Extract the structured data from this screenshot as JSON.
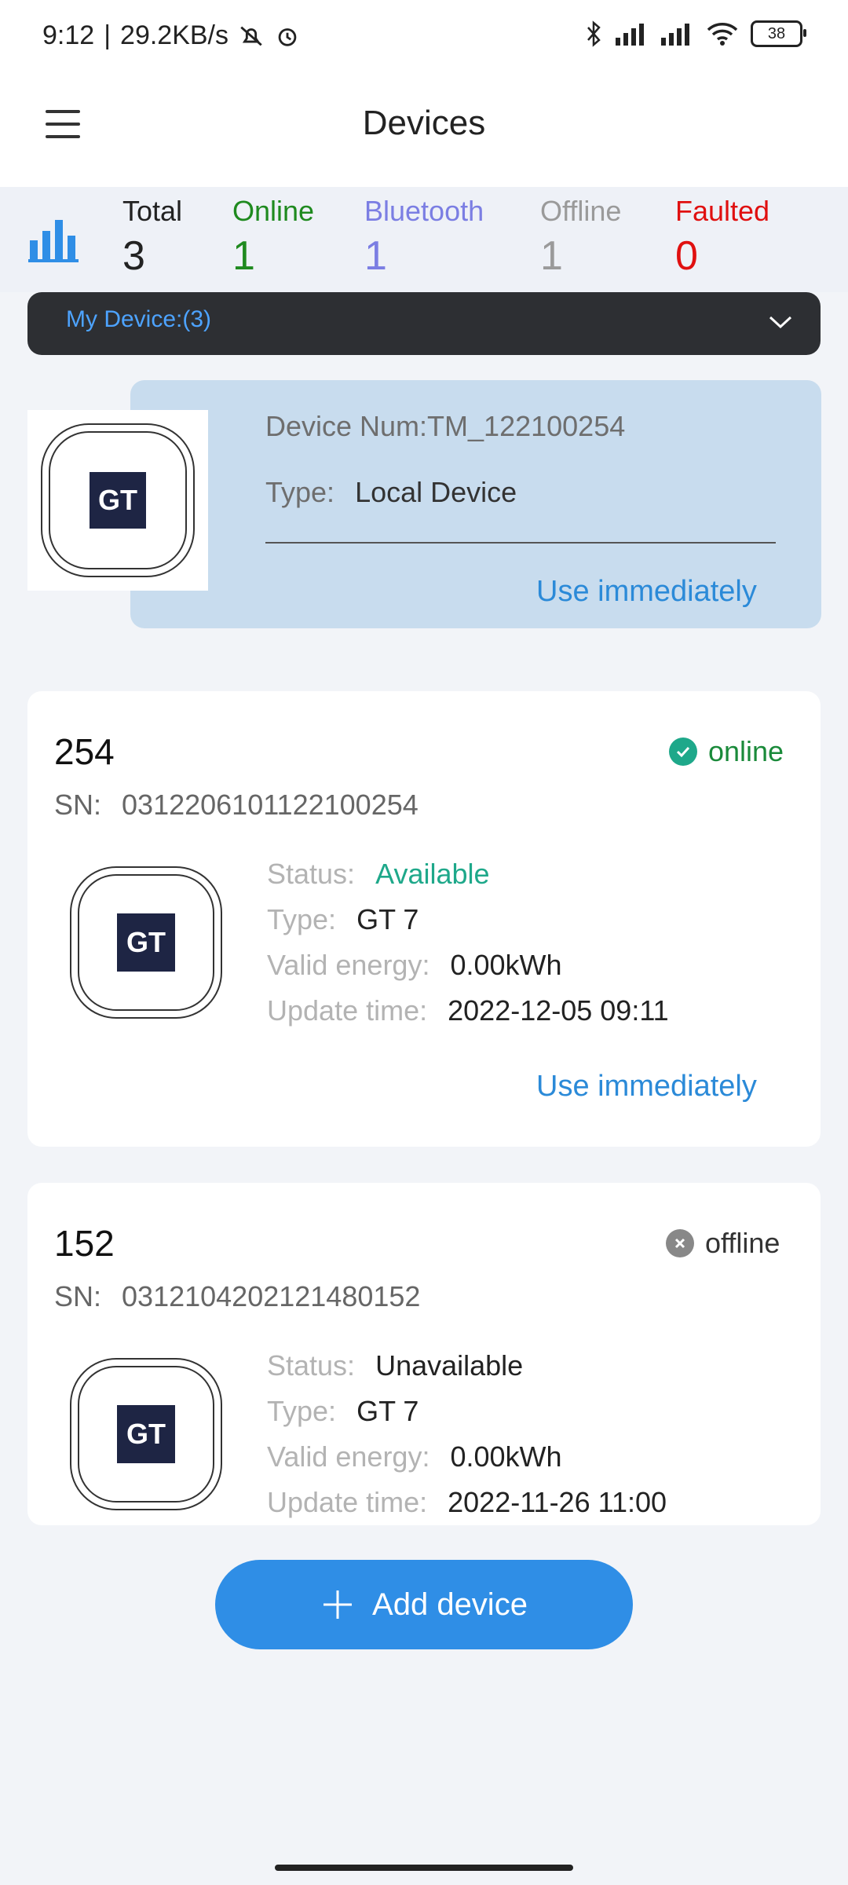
{
  "status_bar": {
    "time": "9:12",
    "speed": "29.2KB/s",
    "battery": "38"
  },
  "header": {
    "title": "Devices"
  },
  "stats": {
    "total_label": "Total",
    "total_value": "3",
    "online_label": "Online",
    "online_value": "1",
    "bluetooth_label": "Bluetooth",
    "bluetooth_value": "1",
    "offline_label": "Offline",
    "offline_value": "1",
    "faulted_label": "Faulted",
    "faulted_value": "0",
    "colors": {
      "total": "#222222",
      "online": "#1f8a1f",
      "bluetooth": "#7b7ee3",
      "offline": "#9a9a9a",
      "faulted": "#e01010"
    }
  },
  "dropdown": {
    "label": "My Device:(3)"
  },
  "local_device": {
    "device_num": "Device Num:TM_122100254",
    "type_label": "Type:",
    "type_value": "Local Device",
    "action": "Use immediately",
    "logo_text": "GT"
  },
  "devices": [
    {
      "name": "254",
      "sn_label": "SN:",
      "sn": "0312206101122100254",
      "status_text": "online",
      "status_color": "#1a8a3a",
      "status_label": "Status:",
      "status_value": "Available",
      "status_value_color": "#1ea88a",
      "type_label": "Type:",
      "type_value": "GT 7",
      "energy_label": "Valid energy:",
      "energy_value": "0.00kWh",
      "update_label": "Update time:",
      "update_value": "2022-12-05 09:11",
      "action": "Use immediately",
      "logo_text": "GT"
    },
    {
      "name": "152",
      "sn_label": "SN:",
      "sn": "0312104202121480152",
      "status_text": "offline",
      "status_color": "#333333",
      "status_label": "Status:",
      "status_value": "Unavailable",
      "status_value_color": "#222222",
      "type_label": "Type:",
      "type_value": "GT 7",
      "energy_label": "Valid energy:",
      "energy_value": "0.00kWh",
      "update_label": "Update time:",
      "update_value": "2022-11-26 11:00",
      "logo_text": "GT"
    }
  ],
  "add_button": {
    "label": "Add device"
  }
}
